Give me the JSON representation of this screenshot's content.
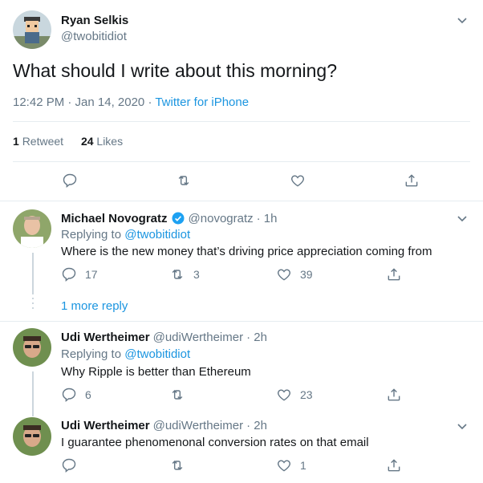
{
  "main_tweet": {
    "name": "Ryan Selkis",
    "handle": "@twobitidiot",
    "text": "What should I write about this morning?",
    "time": "12:42 PM · Jan 14, 2020",
    "separator": " · ",
    "source": "Twitter for iPhone",
    "retweets_count": "1",
    "retweets_label": "Retweet",
    "likes_count": "24",
    "likes_label": "Likes"
  },
  "replies": [
    {
      "name": "Michael Novogratz",
      "verified": true,
      "handle": "@novogratz",
      "time": "· 1h",
      "replying_prefix": "Replying to",
      "replying_to": "@twobitidiot",
      "text": "Where is the new money that’s driving price appreciation coming from",
      "reply_count": "17",
      "retweet_count": "3",
      "like_count": "39",
      "more_replies": "1 more reply"
    },
    {
      "name": "Udi Wertheimer",
      "handle": "@udiWertheimer",
      "time": "· 2h",
      "replying_prefix": "Replying to",
      "replying_to": "@twobitidiot",
      "text": "Why Ripple is better than Ethereum",
      "reply_count": "6",
      "retweet_count": "",
      "like_count": "23"
    },
    {
      "name": "Udi Wertheimer",
      "handle": "@udiWertheimer",
      "time": "· 2h",
      "text": "I guarantee phenomenonal conversion rates on that email",
      "reply_count": "",
      "retweet_count": "",
      "like_count": "1"
    }
  ],
  "colors": {
    "link": "#1b95e0",
    "muted": "#657786",
    "verified": "#1da1f2",
    "divider": "#e6ecf0"
  },
  "icons": [
    "chevron-down-icon",
    "reply-icon",
    "retweet-icon",
    "like-icon",
    "share-icon",
    "verified-icon"
  ]
}
